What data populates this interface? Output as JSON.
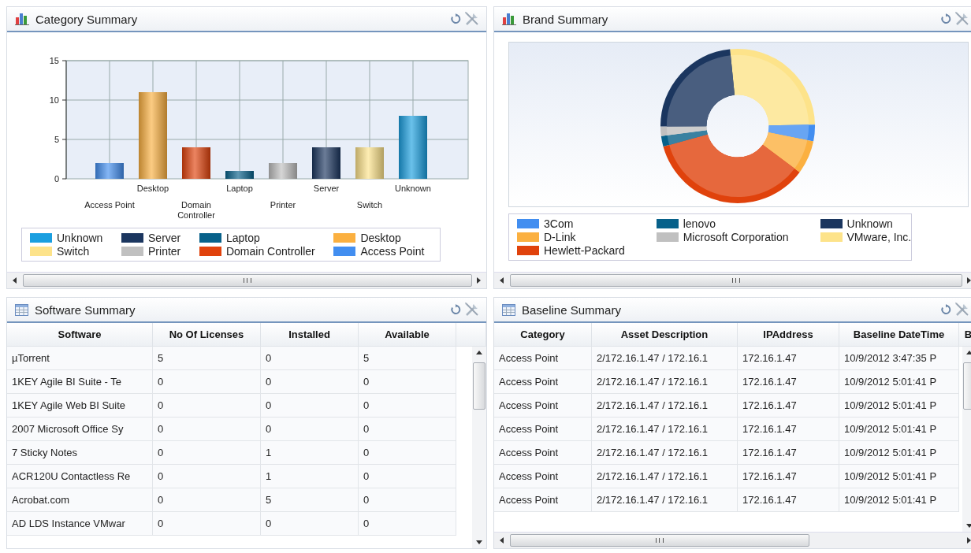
{
  "category_summary": {
    "title": "Category Summary",
    "chart_data": {
      "type": "bar",
      "categories": [
        "Access Point",
        "Desktop",
        "Domain Controller",
        "Laptop",
        "Printer",
        "Server",
        "Switch",
        "Unknown"
      ],
      "values": [
        2,
        11,
        4,
        1,
        2,
        4,
        4,
        8
      ],
      "ylim": [
        0,
        15
      ],
      "yticks": [
        0,
        5,
        10,
        15
      ],
      "grid": true
    },
    "legend": [
      {
        "label": "Unknown",
        "color": "#1a9fe0"
      },
      {
        "label": "Switch",
        "color": "#fde38a"
      },
      {
        "label": "Server",
        "color": "#1b365f"
      },
      {
        "label": "Printer",
        "color": "#c0c0c0"
      },
      {
        "label": "Laptop",
        "color": "#07618a"
      },
      {
        "label": "Domain Controller",
        "color": "#e0420c"
      },
      {
        "label": "Desktop",
        "color": "#fbb040"
      },
      {
        "label": "Access Point",
        "color": "#428ef0"
      }
    ]
  },
  "brand_summary": {
    "title": "Brand Summary",
    "legend": [
      {
        "label": "3Com",
        "color": "#428ef0"
      },
      {
        "label": "lenovo",
        "color": "#07618a"
      },
      {
        "label": "Unknown",
        "color": "#1b365f"
      },
      {
        "label": "D-Link",
        "color": "#fbb040"
      },
      {
        "label": "Microsoft Corporation",
        "color": "#c0c0c0"
      },
      {
        "label": "VMware, Inc.",
        "color": "#fde38a"
      },
      {
        "label": "Hewlett-Packard",
        "color": "#e0420c"
      }
    ]
  },
  "software_summary": {
    "title": "Software Summary",
    "columns": [
      "Software",
      "No Of Licenses",
      "Installed",
      "Available"
    ],
    "rows": [
      [
        "µTorrent",
        "5",
        "0",
        "5"
      ],
      [
        "1KEY Agile BI Suite - Te",
        "0",
        "0",
        "0"
      ],
      [
        "1KEY Agile Web BI Suite",
        "0",
        "0",
        "0"
      ],
      [
        "2007 Microsoft Office Sy",
        "0",
        "0",
        "0"
      ],
      [
        "7 Sticky Notes",
        "0",
        "1",
        "0"
      ],
      [
        "ACR120U Contactless Re",
        "0",
        "1",
        "0"
      ],
      [
        "Acrobat.com",
        "0",
        "5",
        "0"
      ],
      [
        "AD LDS Instance VMwar",
        "0",
        "0",
        "0"
      ]
    ]
  },
  "baseline_summary": {
    "title": "Baseline Summary",
    "columns": [
      "Category",
      "Asset Description",
      "IPAddress",
      "Baseline DateTime",
      "B"
    ],
    "rows": [
      [
        "Access Point",
        "2/172.16.1.47 / 172.16.1",
        "172.16.1.47",
        "10/9/2012 3:47:35 P"
      ],
      [
        "Access Point",
        "2/172.16.1.47 / 172.16.1",
        "172.16.1.47",
        "10/9/2012 5:01:41 P"
      ],
      [
        "Access Point",
        "2/172.16.1.47 / 172.16.1",
        "172.16.1.47",
        "10/9/2012 5:01:41 P"
      ],
      [
        "Access Point",
        "2/172.16.1.47 / 172.16.1",
        "172.16.1.47",
        "10/9/2012 5:01:41 P"
      ],
      [
        "Access Point",
        "2/172.16.1.47 / 172.16.1",
        "172.16.1.47",
        "10/9/2012 5:01:41 P"
      ],
      [
        "Access Point",
        "2/172.16.1.47 / 172.16.1",
        "172.16.1.47",
        "10/9/2012 5:01:41 P"
      ],
      [
        "Access Point",
        "2/172.16.1.47 / 172.16.1",
        "172.16.1.47",
        "10/9/2012 5:01:41 P"
      ]
    ]
  }
}
